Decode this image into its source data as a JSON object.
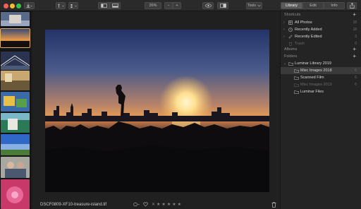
{
  "toolbar": {
    "zoom": "26%",
    "zoom_minus": "−",
    "zoom_plus": "+",
    "tools_label": "Tools",
    "tabs": [
      {
        "label": "Library",
        "active": true
      },
      {
        "label": "Edit",
        "active": false
      },
      {
        "label": "Info",
        "active": false
      }
    ]
  },
  "sidebar": {
    "shortcuts_header": "Shortcuts",
    "shortcuts_add": "+",
    "shortcuts": [
      {
        "label": "All Photos",
        "count": "18",
        "icon": "photos-icon"
      },
      {
        "label": "Recently Added",
        "count": "18",
        "icon": "clock-icon"
      },
      {
        "label": "Recently Edited",
        "count": "3",
        "icon": "edit-icon"
      },
      {
        "label": "Trash",
        "count": "0",
        "icon": "trash-icon",
        "dim": true
      }
    ],
    "albums_header": "Albums",
    "albums_add": "+",
    "folders_header": "Folders",
    "folders_add": "+",
    "folders": [
      {
        "label": "Luminar Library 2019",
        "count": "",
        "level": 0
      },
      {
        "label": "Misc Images 2018",
        "count": "6",
        "level": 1,
        "selected": true
      },
      {
        "label": "Scanned Film",
        "count": "6",
        "level": 1
      },
      {
        "label": "Misc Images 2019",
        "count": "6",
        "level": 1,
        "dim": true
      },
      {
        "label": "Luminar Files",
        "count": "",
        "level": 1
      }
    ]
  },
  "main": {
    "filename": "DSCF0809-XF10-treasure-island.tif",
    "rating": 0,
    "star_glyph": "★",
    "reject_glyph": "✕"
  },
  "colors": {
    "accent": "#e0b060",
    "sidebar_bg": "#242424",
    "toolbar_bg": "#2a2a2a",
    "selected_row": "#3a3a3a"
  }
}
